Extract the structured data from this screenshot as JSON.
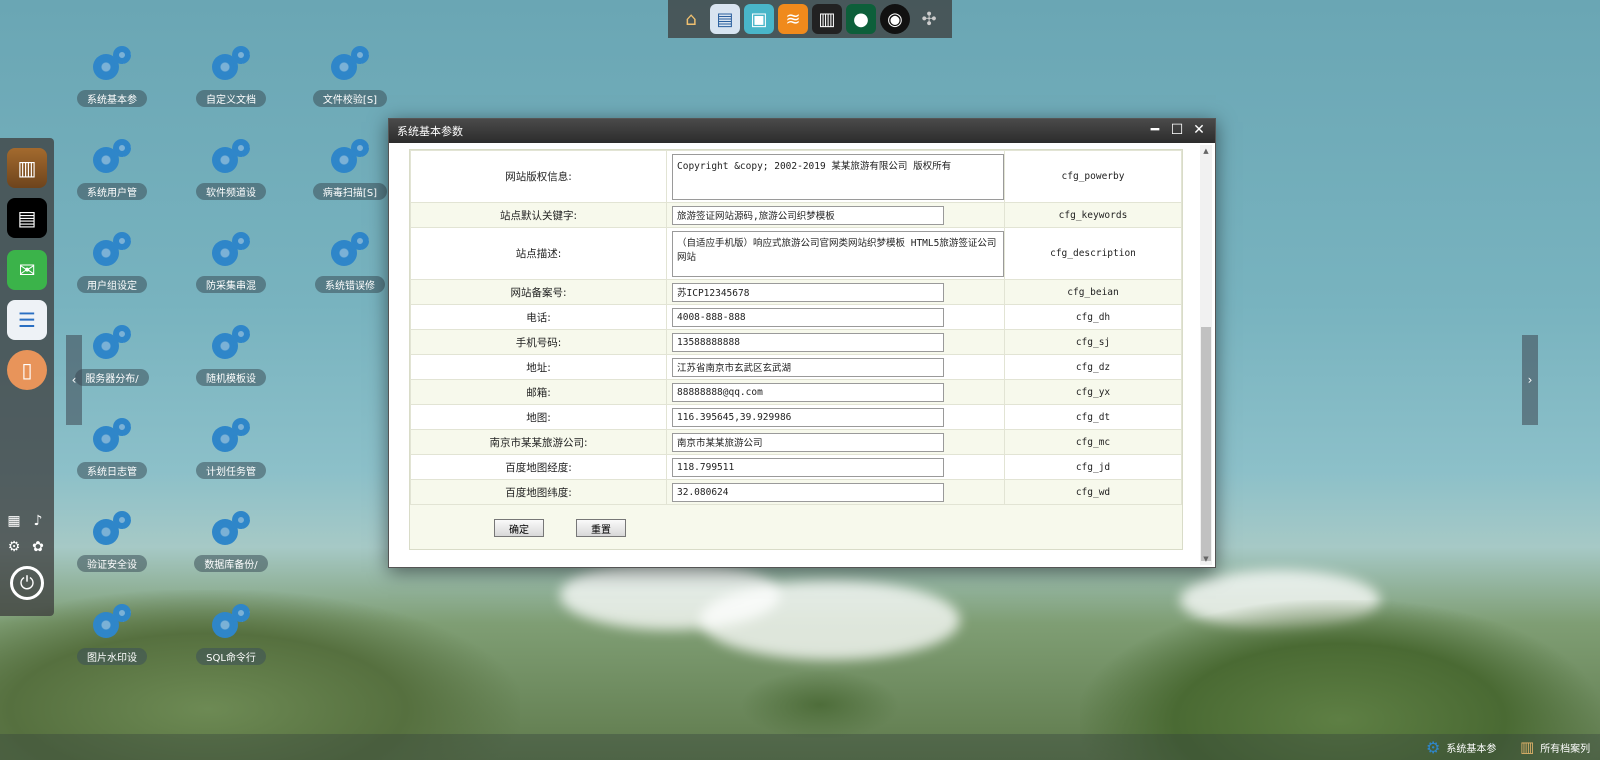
{
  "top_dock": {
    "icons": [
      "home-icon",
      "document-icon",
      "toolbox-icon",
      "stack-icon",
      "wallet-icon",
      "user-icon",
      "ball-icon",
      "robot-icon"
    ]
  },
  "desktop": {
    "icons": [
      {
        "label": "系统基本参"
      },
      {
        "label": "自定义文档"
      },
      {
        "label": "文件校验[S]"
      },
      {
        "label": "系统用户管"
      },
      {
        "label": "软件频道设"
      },
      {
        "label": "病毒扫描[S]"
      },
      {
        "label": "用户组设定"
      },
      {
        "label": "防采集串混"
      },
      {
        "label": "系统错误修"
      },
      {
        "label": "服务器分布/"
      },
      {
        "label": "随机模板设"
      },
      {
        "label": "系统日志管"
      },
      {
        "label": "计划任务管"
      },
      {
        "label": "验证安全设"
      },
      {
        "label": "数据库备份/"
      },
      {
        "label": "图片水印设"
      },
      {
        "label": "SQL命令行"
      }
    ]
  },
  "window": {
    "title": "系统基本参数",
    "rows": [
      {
        "label": "网站版权信息:",
        "value": "Copyright &copy; 2002-2019 某某旅游有限公司 版权所有",
        "key": "cfg_powerby",
        "multiline": true
      },
      {
        "label": "站点默认关键字:",
        "value": "旅游签证网站源码,旅游公司织梦模板",
        "key": "cfg_keywords",
        "multiline": false
      },
      {
        "label": "站点描述:",
        "value": "（自适应手机版）响应式旅游公司官网类网站织梦模板 HTML5旅游签证公司网站",
        "key": "cfg_description",
        "multiline": true
      },
      {
        "label": "网站备案号:",
        "value": "苏ICP12345678",
        "key": "cfg_beian",
        "multiline": false
      },
      {
        "label": "电话:",
        "value": "4008-888-888",
        "key": "cfg_dh",
        "multiline": false
      },
      {
        "label": "手机号码:",
        "value": "13588888888",
        "key": "cfg_sj",
        "multiline": false
      },
      {
        "label": "地址:",
        "value": "江苏省南京市玄武区玄武湖",
        "key": "cfg_dz",
        "multiline": false
      },
      {
        "label": "邮箱:",
        "value": "88888888@qq.com",
        "key": "cfg_yx",
        "multiline": false
      },
      {
        "label": "地图:",
        "value": "116.395645,39.929986",
        "key": "cfg_dt",
        "multiline": false
      },
      {
        "label": "南京市某某旅游公司:",
        "value": "南京市某某旅游公司",
        "key": "cfg_mc",
        "multiline": false
      },
      {
        "label": "百度地图经度:",
        "value": "118.799511",
        "key": "cfg_jd",
        "multiline": false
      },
      {
        "label": "百度地图纬度:",
        "value": "32.080624",
        "key": "cfg_wd",
        "multiline": false
      }
    ],
    "confirm_label": "确定",
    "reset_label": "重置"
  },
  "taskbar": {
    "items": [
      {
        "label": "系统基本参"
      },
      {
        "label": "所有档案列"
      }
    ]
  },
  "colors": {
    "gear_blue": "#2f86c9",
    "row_alt": "#f7f9ec",
    "title_bar": "#333333"
  }
}
